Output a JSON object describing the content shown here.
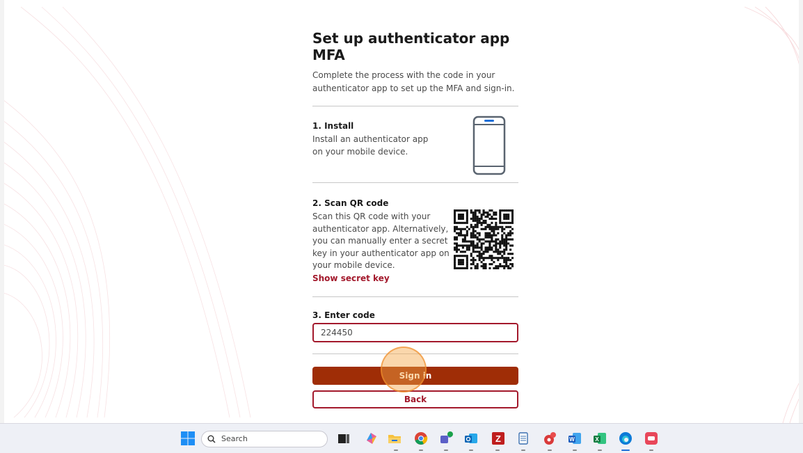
{
  "page": {
    "title": "Set up authenticator app MFA",
    "intro": "Complete the process with the code in your authenticator app to set up the MFA and sign-in."
  },
  "steps": {
    "install": {
      "title": "1. Install",
      "text": "Install an authenticator app on your mobile device.",
      "icon": "smartphone-icon"
    },
    "scan": {
      "title": "2. Scan QR code",
      "text": "Scan this QR code with your authenticator app. Alternatively, you can manually enter a secret key in your authenticator app on your mobile device.",
      "link": "Show secret key",
      "icon": "qr-code"
    },
    "enter": {
      "title": "3. Enter code",
      "value": "224450"
    }
  },
  "actions": {
    "signin": "Sign in",
    "back": "Back"
  },
  "taskbar": {
    "search_placeholder": "Search",
    "apps": [
      "windows-start-icon",
      "task-view-icon",
      "copilot-icon",
      "file-explorer-icon",
      "chrome-icon",
      "teams-icon",
      "outlook-icon",
      "filezilla-icon",
      "notepad-icon",
      "app-icon",
      "word-icon",
      "excel-icon",
      "edge-icon",
      "app-red-icon"
    ]
  },
  "colors": {
    "accent": "#a3192c",
    "primary_button": "#9f2d06",
    "text": "#1a1a1a",
    "muted_text": "#4a4a4a"
  }
}
